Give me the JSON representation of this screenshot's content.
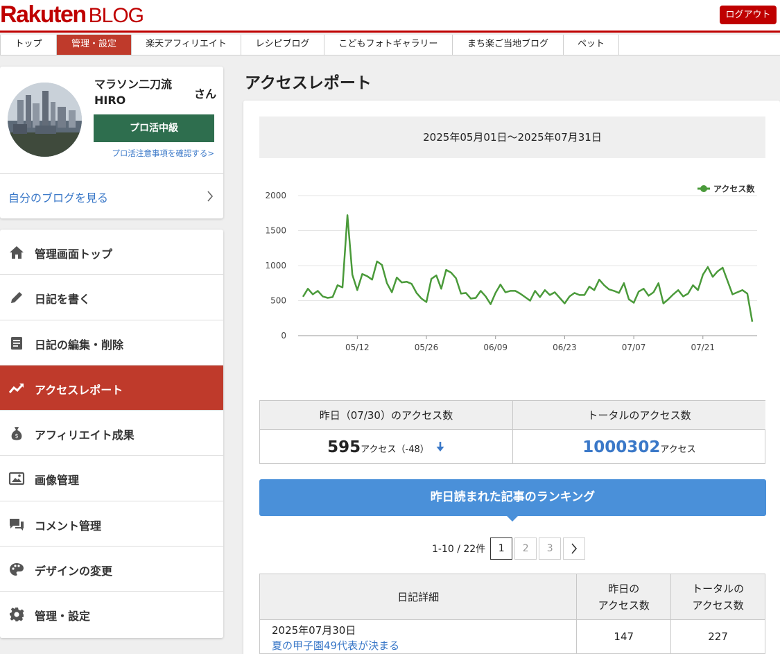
{
  "header": {
    "logo_main": "Rakuten",
    "logo_sub": "BLOG",
    "logout": "ログアウト",
    "accent": "#bf0000"
  },
  "tabs": [
    {
      "label": "トップ",
      "active": false
    },
    {
      "label": "管理・設定",
      "active": true
    },
    {
      "label": "楽天アフィリエイト",
      "active": false
    },
    {
      "label": "レシピブログ",
      "active": false
    },
    {
      "label": "こどもフォトギャラリー",
      "active": false
    },
    {
      "label": "まち楽ご当地ブログ",
      "active": false
    },
    {
      "label": "ペット",
      "active": false
    }
  ],
  "profile": {
    "name_line1": "マラソン二刀流",
    "name_line2": "HIRO",
    "honorific": "さん",
    "rank_button": "プロ活中級",
    "note_link": "プロ活注意事項を確認する>",
    "my_blog_link": "自分のブログを見る"
  },
  "menu": [
    {
      "label": "管理画面トップ",
      "icon": "home-icon",
      "active": false
    },
    {
      "label": "日記を書く",
      "icon": "pencil-icon",
      "active": false
    },
    {
      "label": "日記の編集・削除",
      "icon": "document-icon",
      "active": false
    },
    {
      "label": "アクセスレポート",
      "icon": "trend-icon",
      "active": true
    },
    {
      "label": "アフィリエイト成果",
      "icon": "money-bag-icon",
      "active": false
    },
    {
      "label": "画像管理",
      "icon": "image-icon",
      "active": false
    },
    {
      "label": "コメント管理",
      "icon": "comment-icon",
      "active": false
    },
    {
      "label": "デザインの変更",
      "icon": "palette-icon",
      "active": false
    },
    {
      "label": "管理・設定",
      "icon": "gear-icon",
      "active": false
    }
  ],
  "main": {
    "title": "アクセスレポート",
    "date_range": "2025年05月01日〜2025年07月31日"
  },
  "chart_data": {
    "type": "line",
    "legend": "アクセス数",
    "legend_position": "top-right",
    "color": "#4a9a3a",
    "x_ticks": [
      "05/12",
      "05/26",
      "06/09",
      "06/23",
      "07/07",
      "07/21"
    ],
    "y_ticks": [
      "0",
      "500",
      "1000",
      "1500",
      "2000"
    ],
    "ylim": [
      0,
      2000
    ],
    "x_start": "05/01",
    "series": [
      {
        "name": "アクセス数",
        "values": [
          555,
          670,
          590,
          640,
          560,
          540,
          550,
          720,
          690,
          1720,
          870,
          650,
          880,
          850,
          800,
          1060,
          1010,
          750,
          620,
          830,
          760,
          770,
          740,
          610,
          530,
          480,
          810,
          860,
          670,
          940,
          900,
          820,
          600,
          610,
          530,
          540,
          640,
          560,
          450,
          610,
          730,
          620,
          640,
          640,
          600,
          550,
          500,
          640,
          550,
          650,
          580,
          620,
          540,
          460,
          560,
          610,
          580,
          580,
          700,
          650,
          800,
          720,
          660,
          640,
          610,
          750,
          520,
          470,
          630,
          670,
          570,
          620,
          750,
          460,
          520,
          590,
          650,
          560,
          600,
          720,
          650,
          870,
          980,
          840,
          920,
          970,
          780,
          590,
          620,
          650,
          600,
          200
        ]
      }
    ]
  },
  "stats": {
    "yesterday_label": "昨日（07/30）のアクセス数",
    "yesterday_value": "595",
    "yesterday_unit": "アクセス（-48）",
    "total_label": "トータルのアクセス数",
    "total_value": "1000302",
    "total_unit": "アクセス"
  },
  "ranking": {
    "title": "昨日読まれた記事のランキング",
    "count": "1-10 / 22件",
    "pages": [
      "1",
      "2",
      "3"
    ],
    "next": ">",
    "headers": {
      "detail": "日記詳細",
      "yesterday_l1": "昨日の",
      "yesterday_l2": "アクセス数",
      "total_l1": "トータルの",
      "total_l2": "アクセス数"
    },
    "rows": [
      {
        "date": "2025年07月30日",
        "title": "夏の甲子園49代表が決まる",
        "yesterday": "147",
        "total": "227"
      }
    ]
  }
}
